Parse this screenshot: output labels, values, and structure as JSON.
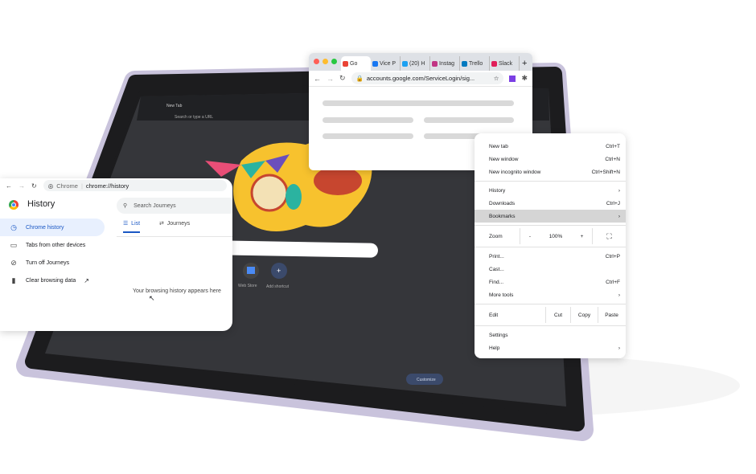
{
  "tablet": {
    "tab_label": "New Tab",
    "omnibox_placeholder": "Search or type a URL",
    "shortcuts": [
      {
        "label": "Web Store"
      },
      {
        "label": "Add shortcut"
      }
    ],
    "customize_label": "Customize",
    "colors": {
      "screen": "#35363a",
      "frame": "#c9c3dc",
      "illustration": "#f7c22e"
    }
  },
  "top_browser": {
    "tabs": [
      {
        "label": "Go",
        "color": "#ea4335"
      },
      {
        "label": "Vice P",
        "color": "#1877f2"
      },
      {
        "label": "(20) H",
        "color": "#1da1f2"
      },
      {
        "label": "Instag",
        "color": "#c13584"
      },
      {
        "label": "Trello",
        "color": "#0079bf"
      },
      {
        "label": "Slack",
        "color": "#e01e5a"
      }
    ],
    "url": "accounts.google.com/ServiceLogin/sig..."
  },
  "history": {
    "breadcrumb_site": "Chrome",
    "url": "chrome://history",
    "title": "History",
    "search_placeholder": "Search Journeys",
    "tabs": [
      {
        "label": "List"
      },
      {
        "label": "Journeys"
      }
    ],
    "sidebar": [
      {
        "label": "Chrome history",
        "icon": "clock"
      },
      {
        "label": "Tabs from other devices",
        "icon": "devices"
      },
      {
        "label": "Turn off Journeys",
        "icon": "journeys-off"
      },
      {
        "label": "Clear browsing data",
        "icon": "trash"
      }
    ],
    "empty_text": "Your browsing history appears here"
  },
  "menu": {
    "items1": [
      {
        "label": "New tab",
        "shortcut": "Ctrl+T"
      },
      {
        "label": "New window",
        "shortcut": "Ctrl+N"
      },
      {
        "label": "New incognito window",
        "shortcut": "Ctrl+Shift+N"
      }
    ],
    "items2": [
      {
        "label": "History",
        "shortcut": "›"
      },
      {
        "label": "Downloads",
        "shortcut": "Ctrl+J"
      },
      {
        "label": "Bookmarks",
        "shortcut": "›"
      }
    ],
    "zoom": {
      "label": "Zoom",
      "minus": "-",
      "value": "100%",
      "plus": "+"
    },
    "items3": [
      {
        "label": "Print...",
        "shortcut": "Ctrl+P"
      },
      {
        "label": "Cast...",
        "shortcut": ""
      },
      {
        "label": "Find...",
        "shortcut": "Ctrl+F"
      },
      {
        "label": "More tools",
        "shortcut": "›"
      }
    ],
    "edit": {
      "label": "Edit",
      "cut": "Cut",
      "copy": "Copy",
      "paste": "Paste"
    },
    "items4": [
      {
        "label": "Settings",
        "shortcut": ""
      },
      {
        "label": "Help",
        "shortcut": "›"
      }
    ]
  }
}
